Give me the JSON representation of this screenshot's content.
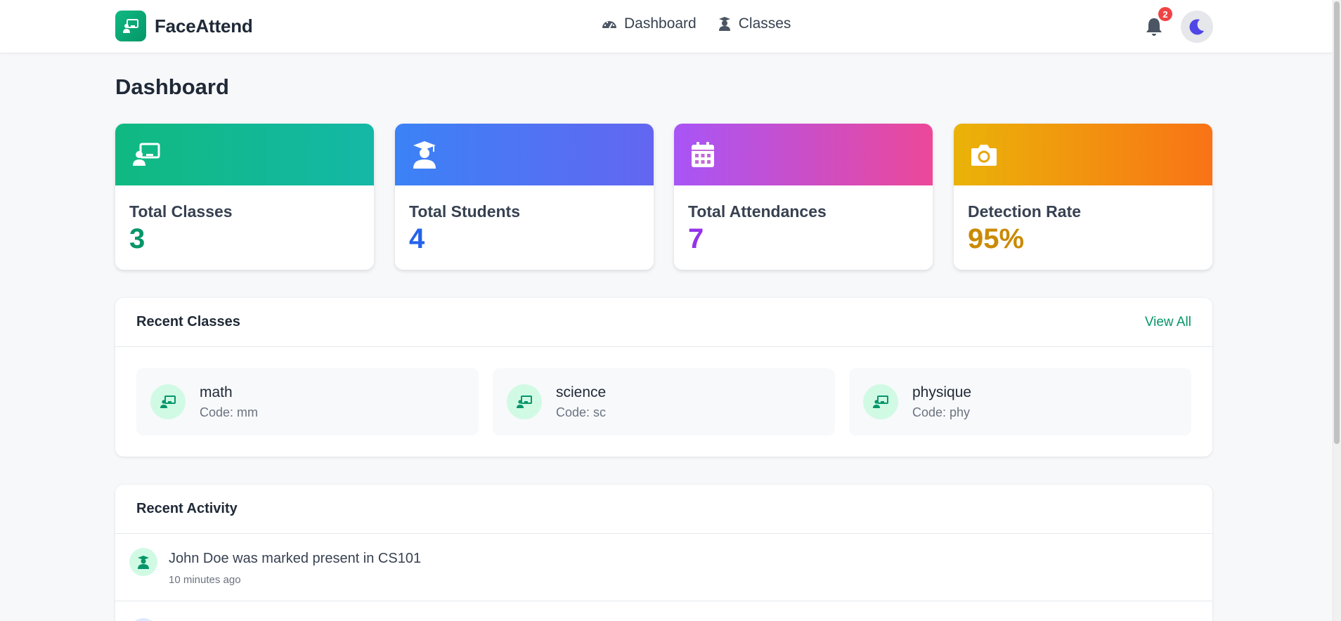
{
  "brand": {
    "name": "FaceAttend"
  },
  "nav": {
    "dashboard": "Dashboard",
    "classes": "Classes"
  },
  "notifications": {
    "count": "2"
  },
  "page": {
    "title": "Dashboard"
  },
  "stats": [
    {
      "label": "Total Classes",
      "value": "3",
      "icon": "chalkboard-teacher-icon",
      "color": "#059669",
      "gradient": [
        "#10b981",
        "#14b8a6"
      ]
    },
    {
      "label": "Total Students",
      "value": "4",
      "icon": "graduate-icon",
      "color": "#2563eb",
      "gradient": [
        "#3b82f6",
        "#6366f1"
      ]
    },
    {
      "label": "Total Attendances",
      "value": "7",
      "icon": "calendar-icon",
      "color": "#9333ea",
      "gradient": [
        "#a855f7",
        "#ec4899"
      ]
    },
    {
      "label": "Detection Rate",
      "value": "95%",
      "icon": "camera-icon",
      "color": "#ca8a04",
      "gradient": [
        "#eab308",
        "#f97316"
      ]
    }
  ],
  "recent_classes": {
    "title": "Recent Classes",
    "view_all": "View All",
    "items": [
      {
        "name": "math",
        "code": "Code: mm"
      },
      {
        "name": "science",
        "code": "Code: sc"
      },
      {
        "name": "physique",
        "code": "Code: phy"
      }
    ]
  },
  "recent_activity": {
    "title": "Recent Activity",
    "items": [
      {
        "text": "John Doe was marked present in CS101",
        "time": "10 minutes ago"
      }
    ]
  },
  "theme": {
    "accent": "#059669",
    "moon_color": "#4f46e5"
  }
}
